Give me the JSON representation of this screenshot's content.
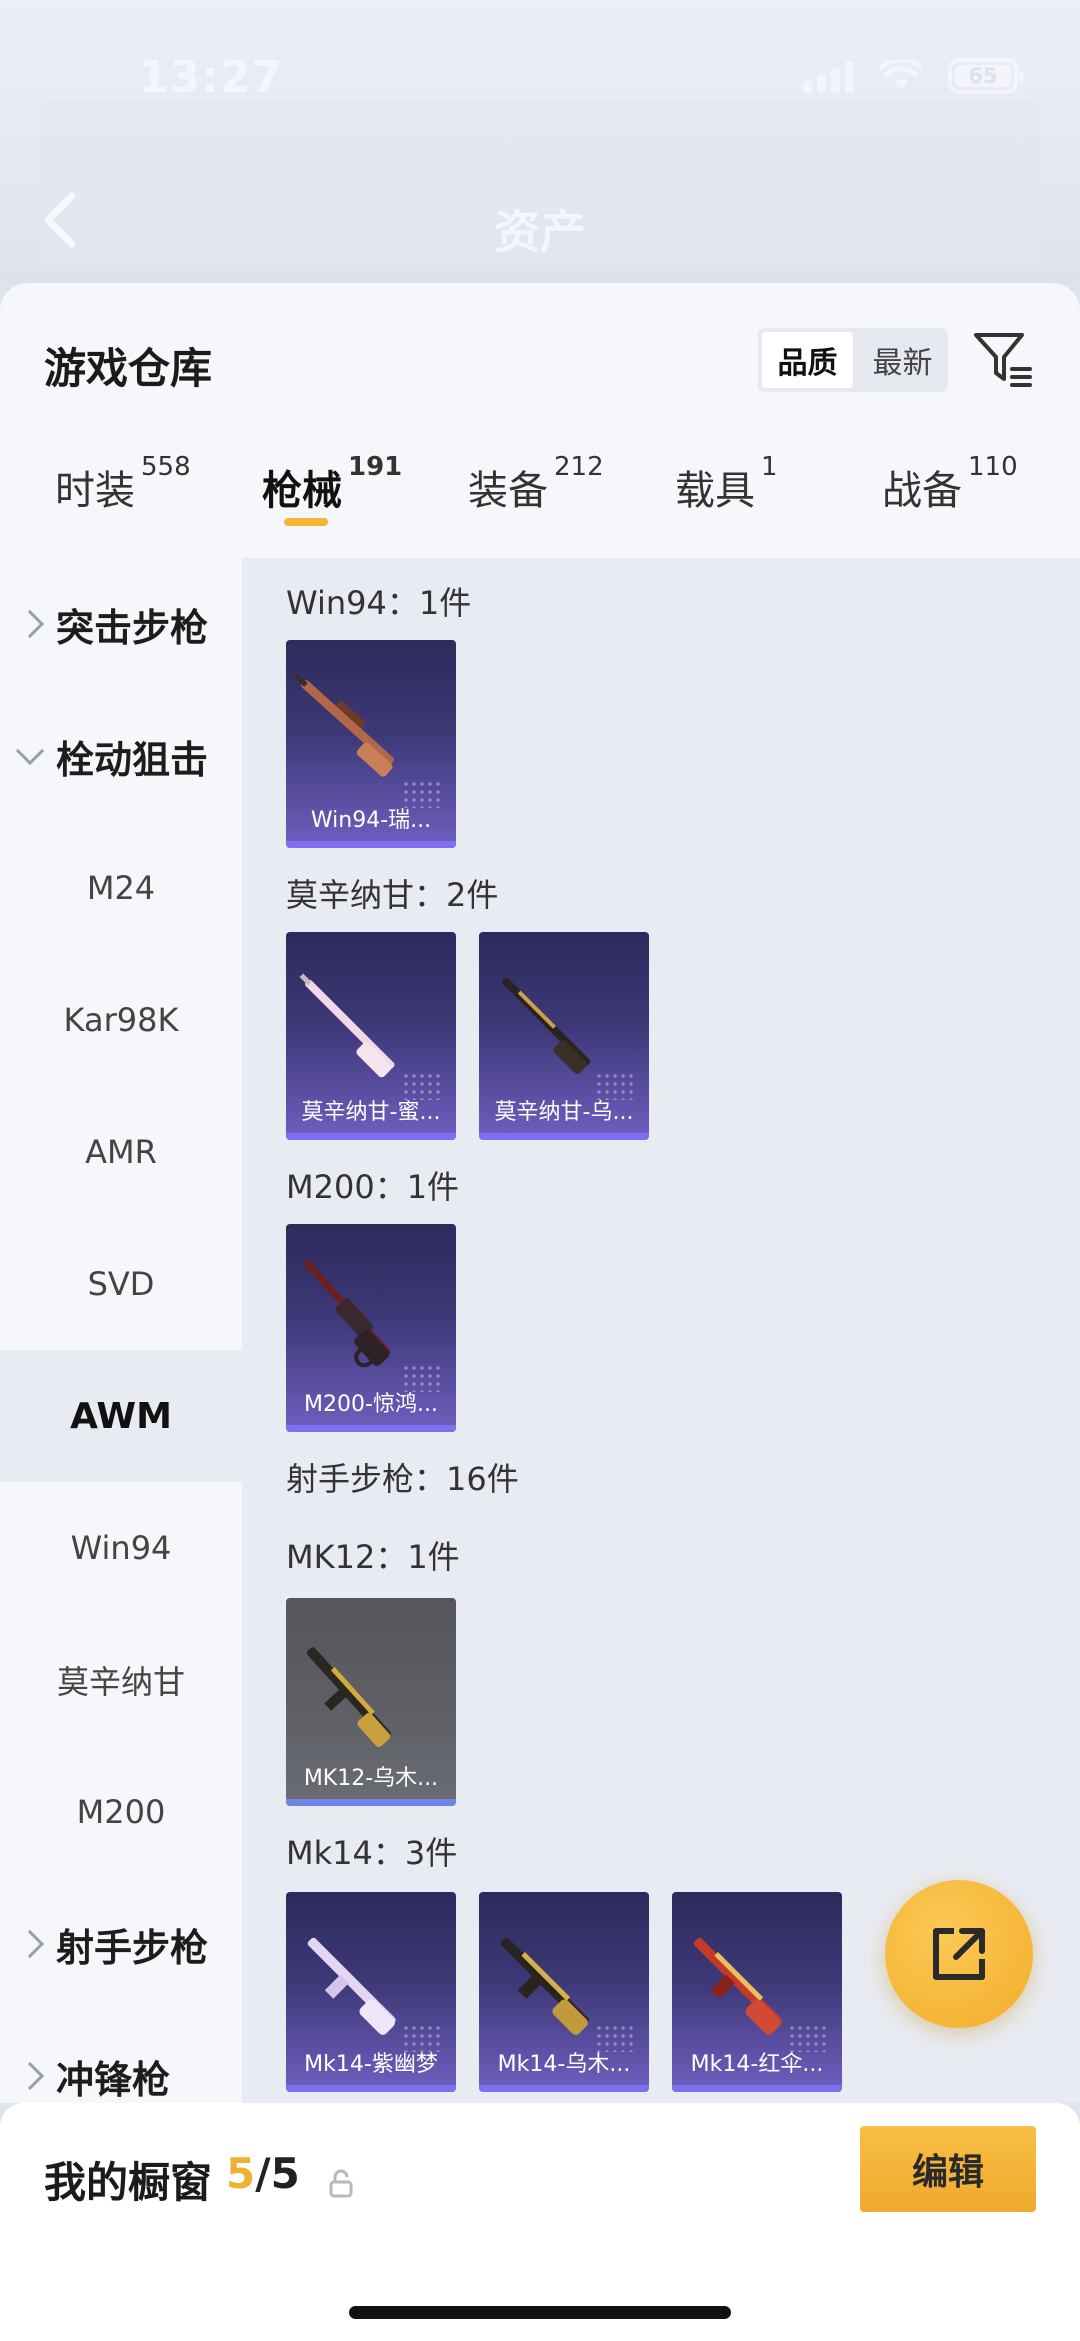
{
  "status_bar": {
    "time": "13:27",
    "battery": "65"
  },
  "nav": {
    "title": "资产"
  },
  "warehouse": {
    "title": "游戏仓库",
    "sort_options": [
      "品质",
      "最新"
    ],
    "tabs": [
      {
        "label": "时装",
        "count": "558"
      },
      {
        "label": "枪械",
        "count": "191"
      },
      {
        "label": "装备",
        "count": "212"
      },
      {
        "label": "载具",
        "count": "1"
      },
      {
        "label": "战备",
        "count": "110"
      }
    ]
  },
  "sidebar": {
    "items": [
      {
        "label": "突击步枪",
        "type": "group",
        "expanded": false
      },
      {
        "label": "栓动狙击",
        "type": "group",
        "expanded": true
      },
      {
        "label": "M24",
        "type": "item"
      },
      {
        "label": "Kar98K",
        "type": "item"
      },
      {
        "label": "AMR",
        "type": "item"
      },
      {
        "label": "SVD",
        "type": "item"
      },
      {
        "label": "AWM",
        "type": "item",
        "selected": true
      },
      {
        "label": "Win94",
        "type": "item"
      },
      {
        "label": "莫辛纳甘",
        "type": "item"
      },
      {
        "label": "M200",
        "type": "item"
      },
      {
        "label": "射手步枪",
        "type": "group",
        "expanded": false
      },
      {
        "label": "冲锋枪",
        "type": "group",
        "expanded": false
      }
    ]
  },
  "sections": [
    {
      "label": "Win94：1件",
      "items": [
        {
          "name": "Win94-瑞...",
          "style": "purple",
          "gun": "rifle-wood"
        }
      ]
    },
    {
      "label": "莫辛纳甘：2件",
      "items": [
        {
          "name": "莫辛纳甘-蜜...",
          "style": "purple",
          "gun": "rifle-white"
        },
        {
          "name": "莫辛纳甘-乌...",
          "style": "purple",
          "gun": "rifle-black"
        }
      ]
    },
    {
      "label": "M200：1件",
      "items": [
        {
          "name": "M200-惊鸿...",
          "style": "purple",
          "gun": "sniper-dark"
        }
      ]
    },
    {
      "label": "射手步枪：16件",
      "items": []
    },
    {
      "label": "MK12：1件",
      "items": [
        {
          "name": "MK12-乌木...",
          "style": "gray",
          "gun": "dmr-gold"
        }
      ]
    },
    {
      "label": "Mk14：3件",
      "items": [
        {
          "name": "Mk14-紫幽梦",
          "style": "purple",
          "gun": "dmr-pink"
        },
        {
          "name": "Mk14-乌木...",
          "style": "purple",
          "gun": "dmr-black"
        },
        {
          "name": "Mk14-红伞...",
          "style": "purple",
          "gun": "dmr-red"
        }
      ]
    }
  ],
  "showcase": {
    "label": "我的橱窗",
    "current": "5",
    "total": "/5",
    "edit_label": "编辑"
  },
  "icons": {
    "back": "chevron-left-icon",
    "filter": "filter-icon",
    "share": "share-external-icon",
    "lock": "lock-icon"
  },
  "colors": {
    "accent": "#f3b437",
    "card_purple": "#3d3877",
    "card_gray": "#5e6066"
  }
}
